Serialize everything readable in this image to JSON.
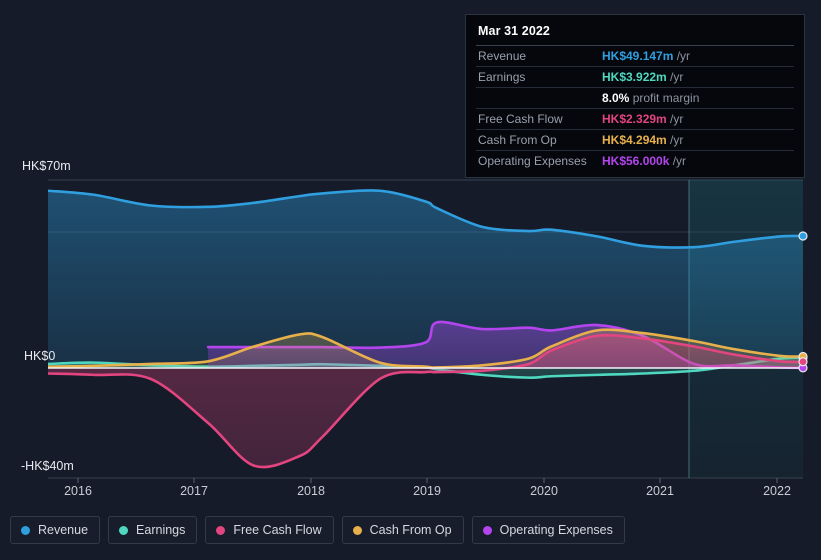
{
  "tooltip": {
    "date": "Mar 31 2022",
    "rows": [
      {
        "key": "Revenue",
        "value": "HK$49.147m",
        "unit": "/yr",
        "color": "#2f9fe0"
      },
      {
        "key": "Earnings",
        "value": "HK$3.922m",
        "unit": "/yr",
        "color": "#4fd8c0"
      },
      {
        "key": "",
        "value": "8.0%",
        "unit": "profit margin",
        "color": "#ffffff"
      },
      {
        "key": "Free Cash Flow",
        "value": "HK$2.329m",
        "unit": "/yr",
        "color": "#e2457f"
      },
      {
        "key": "Cash From Op",
        "value": "HK$4.294m",
        "unit": "/yr",
        "color": "#e8b04b"
      },
      {
        "key": "Operating Expenses",
        "value": "HK$56.000k",
        "unit": "/yr",
        "color": "#b445ee"
      }
    ]
  },
  "legend": [
    {
      "label": "Revenue",
      "color": "#2f9fe0"
    },
    {
      "label": "Earnings",
      "color": "#4fd8c0"
    },
    {
      "label": "Free Cash Flow",
      "color": "#e2457f"
    },
    {
      "label": "Cash From Op",
      "color": "#e8b04b"
    },
    {
      "label": "Operating Expenses",
      "color": "#b445ee"
    }
  ],
  "axis": {
    "y_top_label": "HK$70m",
    "y_zero_label": "HK$0",
    "y_bottom_label": "-HK$40m",
    "x_ticks": [
      "2016",
      "2017",
      "2018",
      "2019",
      "2020",
      "2021",
      "2022"
    ]
  },
  "chart_data": {
    "type": "area",
    "title": "",
    "xlabel": "",
    "ylabel": "HK$",
    "ylim": [
      -40,
      70
    ],
    "yticks": [
      -40,
      0,
      35,
      70
    ],
    "ytick_labels": [
      "-HK$40m",
      "HK$0",
      "",
      "HK$70m"
    ],
    "grid": true,
    "legend_position": "bottom",
    "x_range": [
      2015.6,
      2022.2
    ],
    "forecast_start": "2021.25",
    "x": [
      2015.6,
      2016.0,
      2016.5,
      2017.0,
      2017.4,
      2017.8,
      2018.0,
      2018.5,
      2018.9,
      2019.0,
      2019.4,
      2019.8,
      2020.0,
      2020.4,
      2020.8,
      2021.25,
      2021.6,
      2022.0,
      2022.2
    ],
    "series": [
      {
        "name": "Revenue",
        "color": "#2f9fe0",
        "values": [
          66.0,
          64.5,
          60.5,
          60.0,
          61.5,
          64.0,
          65.0,
          66.0,
          62.0,
          59.5,
          52.5,
          51.0,
          51.5,
          49.0,
          45.5,
          45.0,
          47.0,
          49.0,
          49.147
        ]
      },
      {
        "name": "Earnings",
        "color": "#4fd8c0",
        "values": [
          1.5,
          2.0,
          1.0,
          0.5,
          0.8,
          1.2,
          1.4,
          0.8,
          0.2,
          -0.5,
          -2.5,
          -3.5,
          -3.0,
          -2.5,
          -2.0,
          -1.0,
          1.0,
          3.5,
          3.922
        ]
      },
      {
        "name": "Free Cash Flow",
        "color": "#e2457f",
        "values": [
          -2.0,
          -2.5,
          -4.0,
          -20.0,
          -35.5,
          -32.0,
          -25.0,
          -4.0,
          -1.5,
          -1.5,
          -1.0,
          1.5,
          6.5,
          12.0,
          11.0,
          8.0,
          5.0,
          2.5,
          2.329
        ]
      },
      {
        "name": "Cash From Op",
        "color": "#e8b04b",
        "values": [
          0.5,
          0.8,
          1.5,
          2.5,
          8.0,
          12.5,
          11.5,
          2.0,
          0.5,
          0.2,
          1.0,
          3.5,
          8.0,
          14.0,
          13.0,
          10.0,
          7.0,
          4.5,
          4.294
        ]
      },
      {
        "name": "Operating Expenses",
        "color": "#b445ee",
        "values": [
          null,
          null,
          null,
          7.8,
          7.8,
          7.8,
          7.8,
          7.6,
          9.5,
          17.0,
          14.5,
          15.0,
          14.0,
          16.0,
          12.0,
          1.5,
          1.0,
          0.2,
          0.056
        ]
      }
    ]
  }
}
